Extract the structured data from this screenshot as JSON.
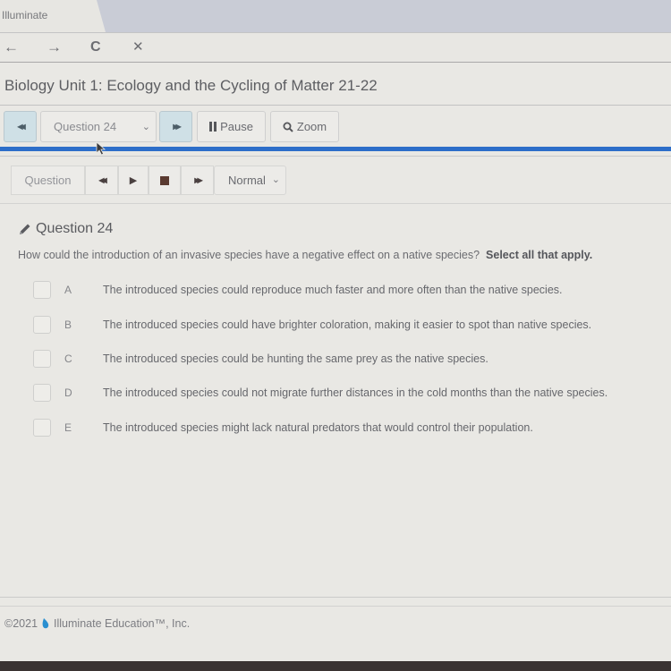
{
  "browser": {
    "tab_title": "Illuminate",
    "nav": {
      "back_icon": "←",
      "forward_icon": "→",
      "reload_icon": "C",
      "stop_icon": "✕"
    }
  },
  "page": {
    "title": "Biology Unit 1: Ecology and the Cycling of Matter 21-22"
  },
  "toolbar": {
    "prev_icon": "◀◀",
    "question_select": "Question 24",
    "next_icon": "▶▶",
    "pause_label": "Pause",
    "zoom_label": "Zoom",
    "progress_fraction": 1.0,
    "accent_color": "#2d6ec9"
  },
  "audio": {
    "question_label": "Question",
    "rewind_icon": "◀◀",
    "play_icon": "▶",
    "stop_icon": "■",
    "forward_icon": "▶▶",
    "speed_select": "Normal"
  },
  "question": {
    "heading": "Question 24",
    "prompt": "How could the introduction of an invasive species have a negative effect on a native species?",
    "instruction": "Select all that apply.",
    "options": [
      {
        "letter": "A",
        "text": "The introduced species could reproduce much faster and more often than the native species.",
        "checked": false
      },
      {
        "letter": "B",
        "text": "The introduced species could have brighter coloration, making it easier to spot than native species.",
        "checked": false
      },
      {
        "letter": "C",
        "text": "The introduced species could be hunting the same prey as the native species.",
        "checked": false
      },
      {
        "letter": "D",
        "text": "The introduced species could not migrate further distances in the cold months than the native species.",
        "checked": false
      },
      {
        "letter": "E",
        "text": "The introduced species might lack natural predators that would control their population.",
        "checked": false
      }
    ]
  },
  "footer": {
    "copyright": "©2021",
    "company": "Illuminate Education™, Inc."
  }
}
